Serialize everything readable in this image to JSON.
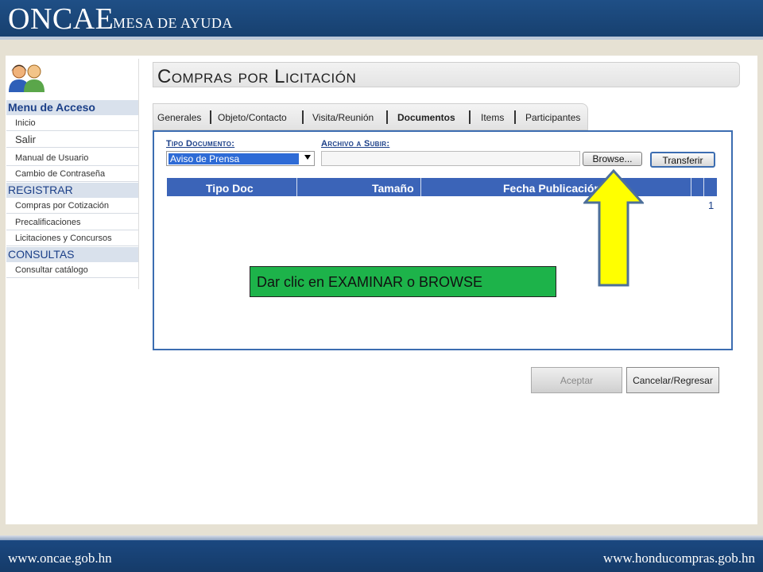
{
  "header": {
    "brand": "ONCAE",
    "subtitle": "MESA DE AYUDA"
  },
  "footer": {
    "left_url": "www.oncae.gob.hn",
    "right_url": "www.honducompras.gob.hn"
  },
  "sidebar": {
    "logo_icon": "users-icon",
    "sections": [
      {
        "title": "Menu de Acceso",
        "items": [
          "Inicio",
          "Salir",
          "Manual de Usuario",
          "Cambio de Contraseña"
        ]
      },
      {
        "title": "REGISTRAR",
        "items": [
          "Compras por Cotización",
          "Precalificaciones",
          "Licitaciones y Concursos"
        ]
      },
      {
        "title": "CONSULTAS",
        "items": [
          "Consultar catálogo"
        ]
      }
    ]
  },
  "page": {
    "title": "Compras por Licitación",
    "tabs": [
      "Generales",
      "Objeto/Contacto",
      "Visita/Reunión",
      "Documentos",
      "Items",
      "Participantes"
    ],
    "active_tab": "Documentos"
  },
  "form": {
    "tipo_label": "Tipo Documento:",
    "tipo_value": "Aviso de Prensa",
    "archivo_label": "Archivo a Subir:",
    "browse_label": "Browse...",
    "transfer_label": "Transferir"
  },
  "table": {
    "columns": [
      "Tipo Doc",
      "Tamaño",
      "Fecha Publicación"
    ],
    "page_number": "1"
  },
  "annotation": {
    "callout_text": "Dar clic en EXAMINAR o BROWSE",
    "arrow_color": "#ffff00",
    "callout_color": "#1db34a"
  },
  "actions": {
    "accept_label": "Aceptar",
    "cancel_label": "Cancelar/Regresar"
  }
}
